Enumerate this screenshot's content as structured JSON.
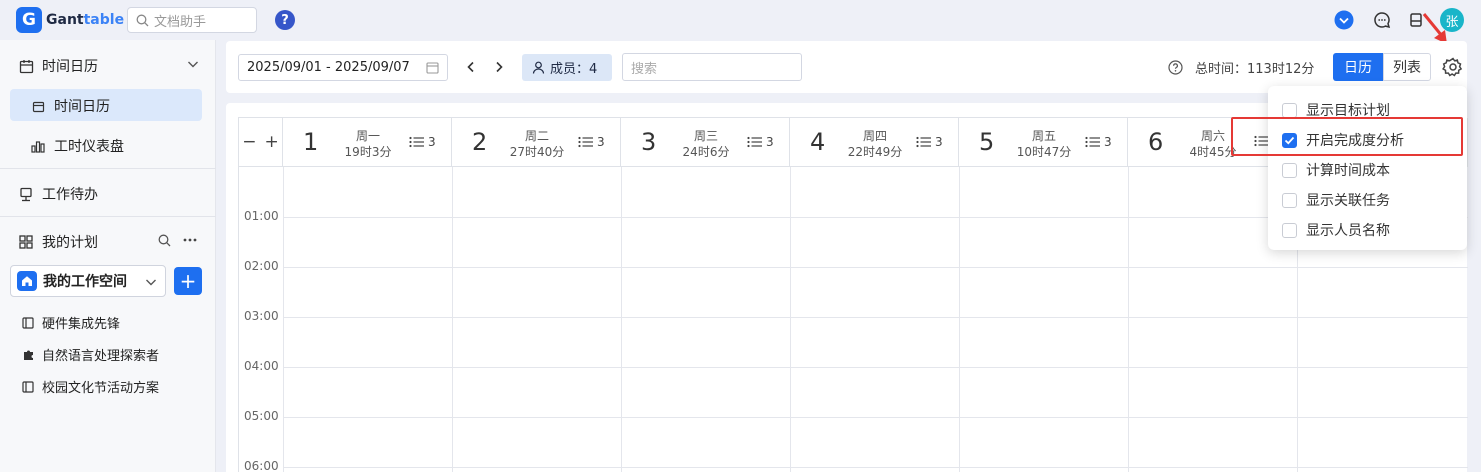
{
  "app": {
    "logo_letter": "G",
    "name_part1": "Gant",
    "name_part2": "table"
  },
  "header": {
    "doc_search_placeholder": "文档助手",
    "help_label": "?",
    "avatar_text": "张"
  },
  "sidebar": {
    "time_calendar_group": "时间日历",
    "time_calendar_item": "时间日历",
    "dashboard_item": "工时仪表盘",
    "todo_item": "工作待办",
    "my_plans": "我的计划",
    "workspace": "我的工作空间",
    "add_label": "+",
    "projects": [
      "硬件集成先锋",
      "自然语言处理探索者",
      "校园文化节活动方案"
    ]
  },
  "toolbar": {
    "date_range": "2025/09/01 - 2025/09/07",
    "members_label": "成员：4",
    "search_placeholder": "搜索",
    "total_time": "总时间：113时12分",
    "view_calendar": "日历",
    "view_list": "列表"
  },
  "calendar": {
    "zoom_minus": "−",
    "zoom_plus": "+",
    "days": [
      {
        "num": "1",
        "name": "周一",
        "hours": "19时3分",
        "count": "3"
      },
      {
        "num": "2",
        "name": "周二",
        "hours": "27时40分",
        "count": "3"
      },
      {
        "num": "3",
        "name": "周三",
        "hours": "24时6分",
        "count": "3"
      },
      {
        "num": "4",
        "name": "周四",
        "hours": "22时49分",
        "count": "3"
      },
      {
        "num": "5",
        "name": "周五",
        "hours": "10时47分",
        "count": "3"
      },
      {
        "num": "6",
        "name": "周六",
        "hours": "4时45分",
        "count": ""
      }
    ],
    "hours": [
      "01:00",
      "02:00",
      "03:00",
      "04:00",
      "05:00",
      "06:00"
    ]
  },
  "settings_menu": {
    "options": [
      {
        "label": "显示目标计划",
        "checked": false
      },
      {
        "label": "开启完成度分析",
        "checked": true
      },
      {
        "label": "计算时间成本",
        "checked": false
      },
      {
        "label": "显示关联任务",
        "checked": false
      },
      {
        "label": "显示人员名称",
        "checked": false
      }
    ]
  },
  "colors": {
    "accent": "#1e6ff0",
    "highlight": "#e53935",
    "avatar": "#19b5c9"
  }
}
